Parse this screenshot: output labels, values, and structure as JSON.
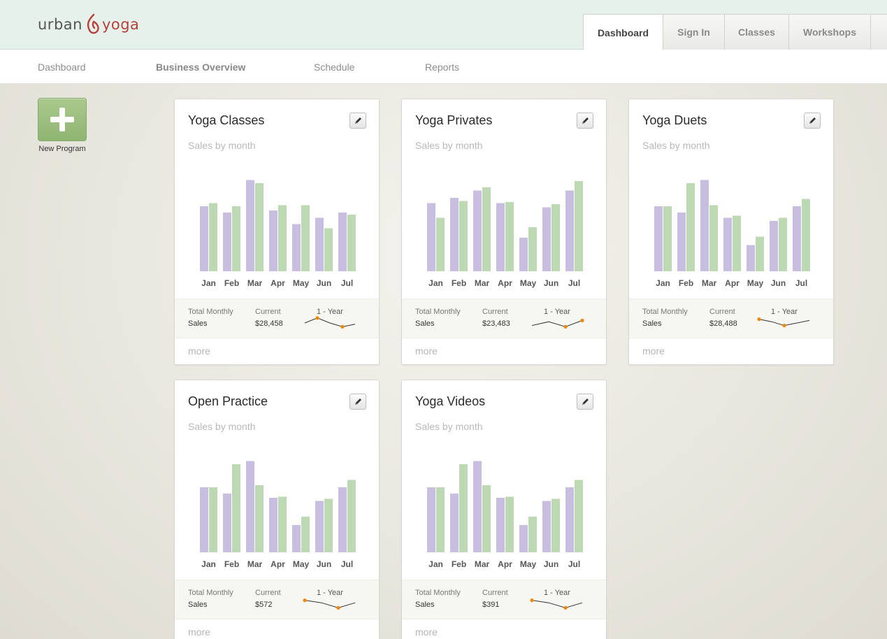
{
  "header": {
    "logo": {
      "word1": "urban",
      "word2": "yoga"
    },
    "tabs": [
      {
        "label": "Dashboard",
        "active": true
      },
      {
        "label": "Sign In"
      },
      {
        "label": "Classes"
      },
      {
        "label": "Workshops"
      }
    ]
  },
  "subnav": {
    "items": [
      {
        "label": "Dashboard"
      },
      {
        "label": "Business Overview",
        "active": true
      },
      {
        "label": "Schedule"
      },
      {
        "label": "Reports"
      }
    ]
  },
  "new_program": {
    "label": "New Program"
  },
  "colors": {
    "purple_bar": "#c8bedf",
    "green_bar": "#bcd9b3",
    "spark_dot": "#f2880b",
    "brand_red": "#b8403a"
  },
  "icons": {
    "edit": "pencil-icon",
    "add": "plus-icon"
  },
  "card_labels": {
    "subtitle": "Sales by month",
    "total_l1": "Total Monthly",
    "total_l2": "Sales",
    "current": "Current",
    "year": "1 - Year",
    "more": "more"
  },
  "chart_data": [
    {
      "type": "bar",
      "title": "Yoga Classes",
      "categories": [
        "Jan",
        "Feb",
        "Mar",
        "Apr",
        "May",
        "Jun",
        "Jul"
      ],
      "series": [
        {
          "values": [
            62,
            56,
            87,
            58,
            45,
            51,
            56
          ]
        },
        {
          "values": [
            65,
            62,
            84,
            63,
            63,
            41,
            54
          ]
        }
      ],
      "ylim": [
        0,
        100
      ],
      "current": "$28,458",
      "spark": [
        5,
        9,
        5,
        2,
        4
      ]
    },
    {
      "type": "bar",
      "title": "Yoga Privates",
      "categories": [
        "Jan",
        "Feb",
        "Mar",
        "Apr",
        "May",
        "Jun",
        "Jul"
      ],
      "series": [
        {
          "values": [
            65,
            70,
            77,
            65,
            32,
            61,
            77
          ]
        },
        {
          "values": [
            51,
            67,
            80,
            66,
            42,
            64,
            86
          ]
        }
      ],
      "ylim": [
        0,
        100
      ],
      "current": "$23,483",
      "spark": [
        3,
        6,
        2,
        7
      ]
    },
    {
      "type": "bar",
      "title": "Yoga Duets",
      "categories": [
        "Jan",
        "Feb",
        "Mar",
        "Apr",
        "May",
        "Jun",
        "Jul"
      ],
      "series": [
        {
          "values": [
            62,
            56,
            87,
            51,
            25,
            48,
            62
          ]
        },
        {
          "values": [
            62,
            84,
            63,
            53,
            33,
            51,
            69
          ]
        }
      ],
      "ylim": [
        0,
        100
      ],
      "current": "$28,488",
      "spark": [
        8,
        6,
        3,
        5,
        7
      ]
    },
    {
      "type": "bar",
      "title": "Open Practice",
      "categories": [
        "Jan",
        "Feb",
        "Mar",
        "Apr",
        "May",
        "Jun",
        "Jul"
      ],
      "series": [
        {
          "values": [
            62,
            56,
            87,
            52,
            26,
            49,
            62
          ]
        },
        {
          "values": [
            62,
            84,
            64,
            53,
            34,
            51,
            69
          ]
        }
      ],
      "ylim": [
        0,
        100
      ],
      "current": "$572",
      "spark": [
        8,
        6,
        2,
        6
      ]
    },
    {
      "type": "bar",
      "title": "Yoga Videos",
      "categories": [
        "Jan",
        "Feb",
        "Mar",
        "Apr",
        "May",
        "Jun",
        "Jul"
      ],
      "series": [
        {
          "values": [
            62,
            56,
            87,
            52,
            26,
            49,
            62
          ]
        },
        {
          "values": [
            62,
            84,
            64,
            53,
            34,
            51,
            69
          ]
        }
      ],
      "ylim": [
        0,
        100
      ],
      "current": "$391",
      "spark": [
        8,
        6,
        2,
        6
      ]
    }
  ]
}
